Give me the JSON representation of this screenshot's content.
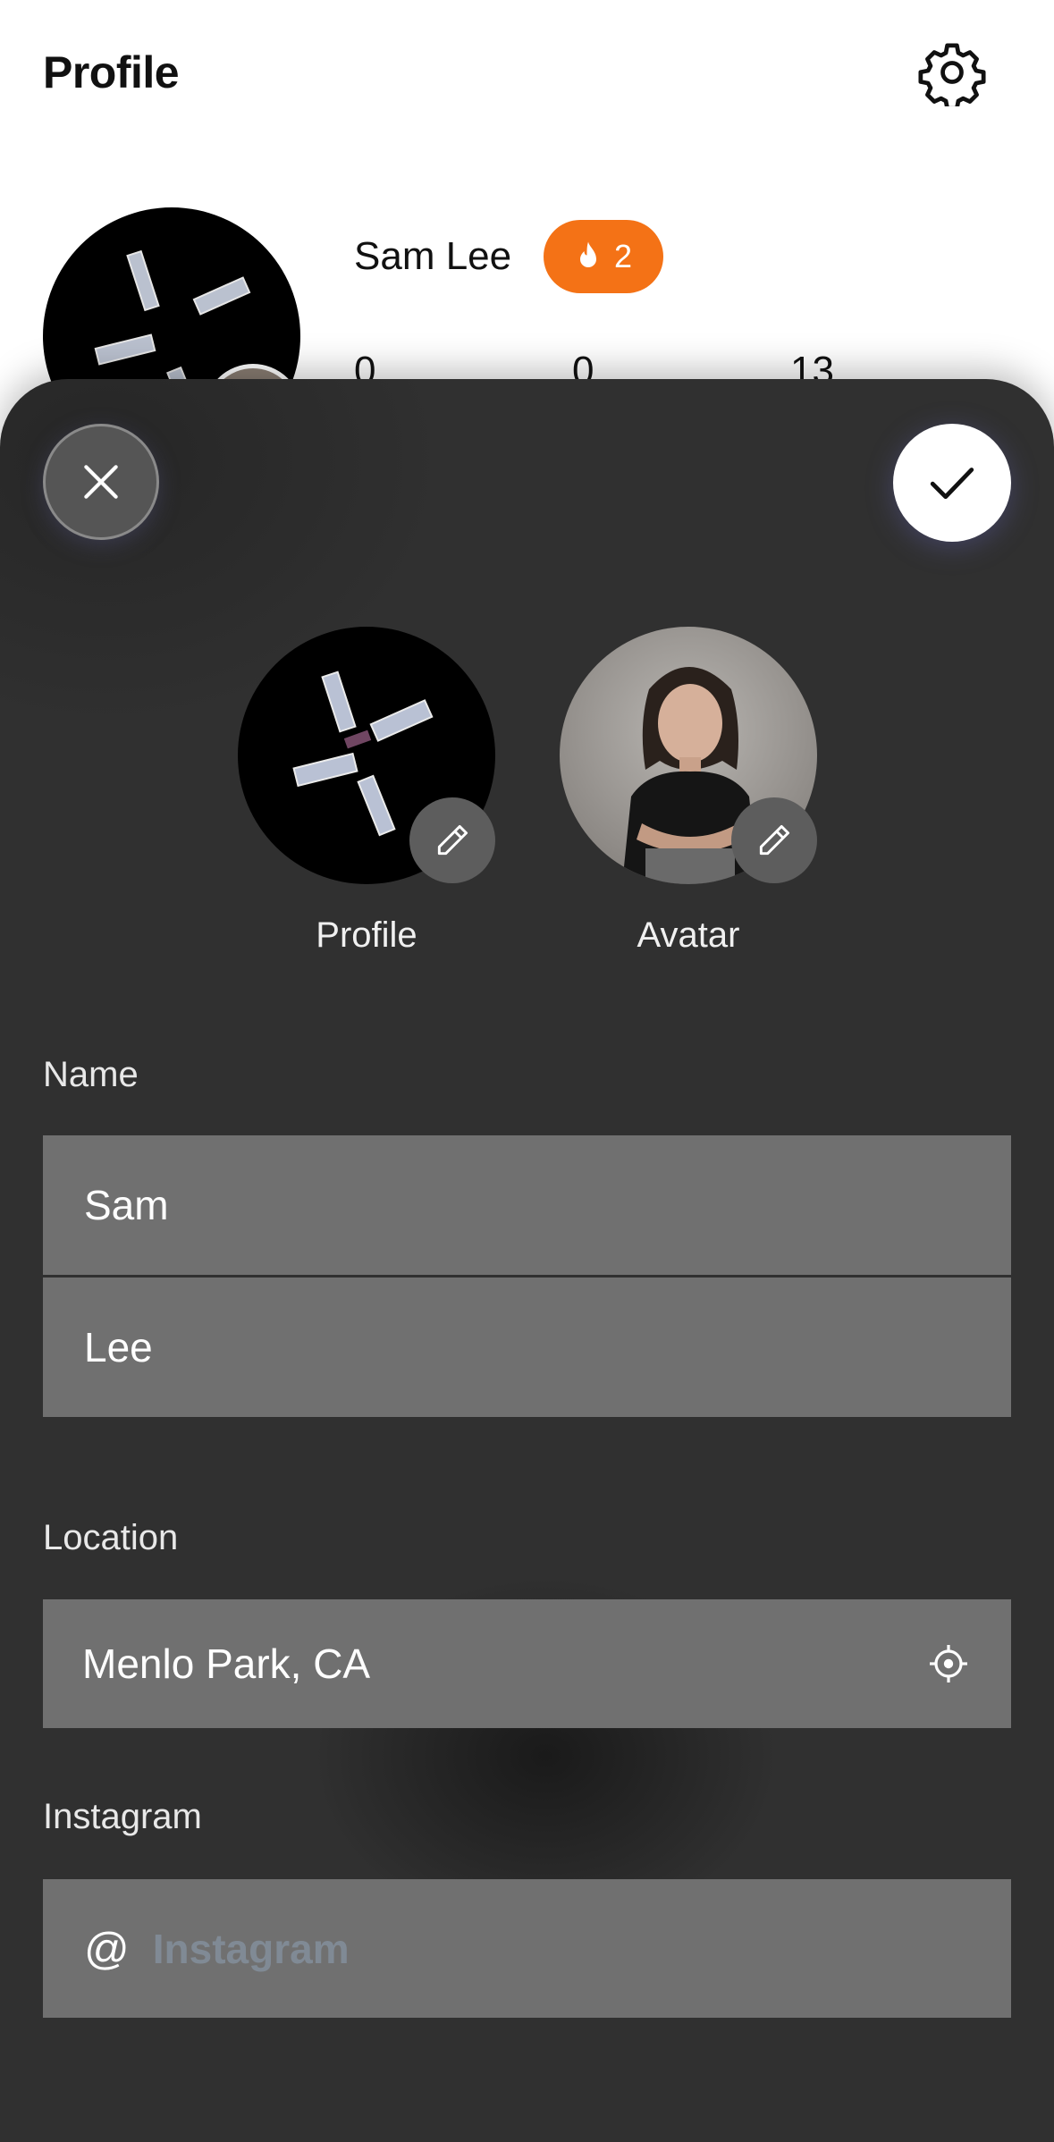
{
  "background": {
    "page_title": "Profile",
    "user_name": "Sam Lee",
    "streak_count": "2",
    "stats": [
      "0",
      "0",
      "13"
    ],
    "streak_color": "#f47216"
  },
  "sheet": {
    "close_icon": "close-icon",
    "confirm_icon": "check-icon",
    "photos": {
      "profile_label": "Profile",
      "avatar_label": "Avatar"
    },
    "name": {
      "label": "Name",
      "first": "Sam",
      "last": "Lee"
    },
    "location": {
      "label": "Location",
      "value": "Menlo Park, CA",
      "icon": "locate-icon"
    },
    "instagram": {
      "label": "Instagram",
      "prefix": "@",
      "placeholder": "Instagram"
    }
  }
}
